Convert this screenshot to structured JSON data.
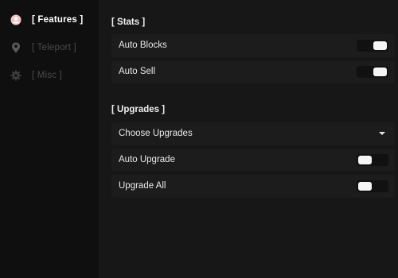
{
  "sidebar": {
    "tabs": [
      {
        "label": "[ Features ]",
        "icon": "user-icon",
        "active": true
      },
      {
        "label": "[ Teleport ]",
        "icon": "map-pin-icon",
        "active": false
      },
      {
        "label": "[ Misc ]",
        "icon": "gear-icon",
        "active": false
      }
    ]
  },
  "stats": {
    "title": "[ Stats ]",
    "auto_blocks": {
      "label": "Auto Blocks",
      "enabled": true
    },
    "auto_sell": {
      "label": "Auto Sell",
      "enabled": true
    }
  },
  "upgrades": {
    "title": "[ Upgrades ]",
    "dropdown": {
      "label": "Choose Upgrades"
    },
    "auto_upgrade": {
      "label": "Auto Upgrade",
      "enabled": false
    },
    "upgrade_all": {
      "label": "Upgrade All",
      "enabled": false
    }
  },
  "colors": {
    "avatar": "#f4c2c6",
    "active_text": "#ffffff",
    "inactive_text": "#4b4b4b"
  }
}
